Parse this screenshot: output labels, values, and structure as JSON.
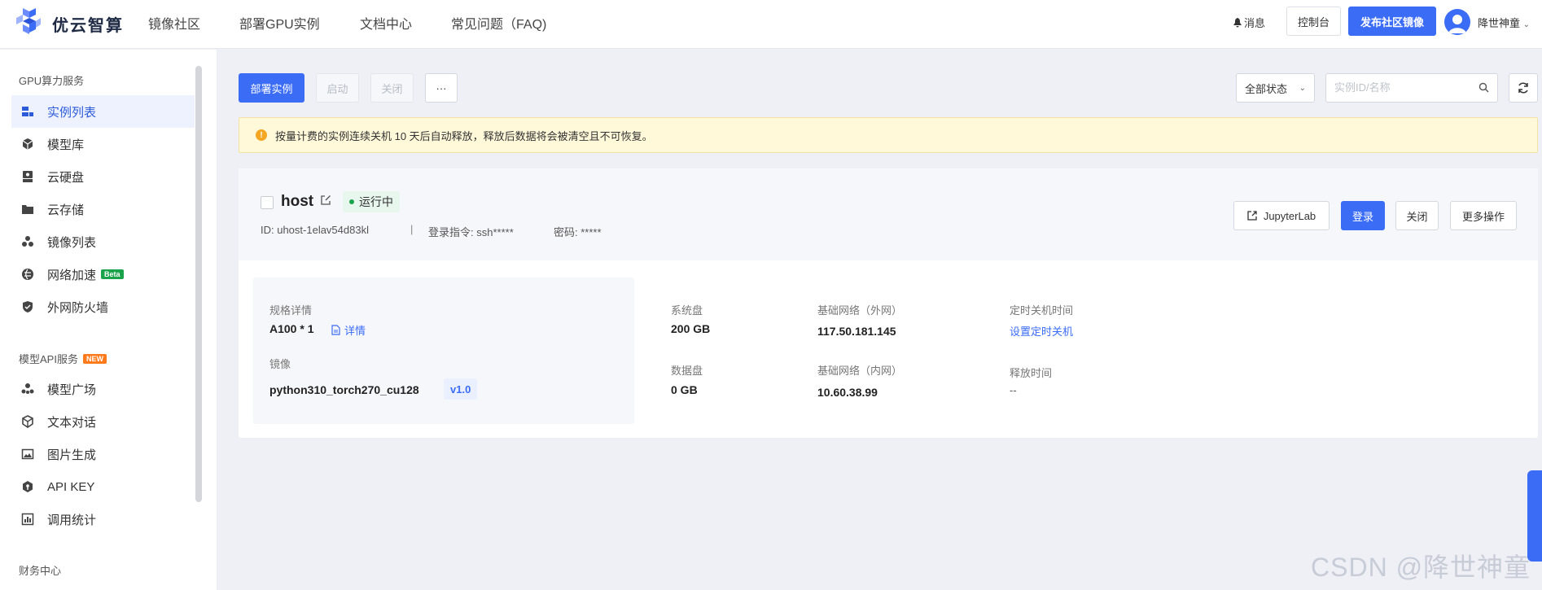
{
  "brand": {
    "name": "优云智算"
  },
  "topnav": [
    {
      "label": "镜像社区"
    },
    {
      "label": "部署GPU实例"
    },
    {
      "label": "文档中心"
    },
    {
      "label": "常见问题（FAQ)"
    }
  ],
  "header": {
    "messages": "消息",
    "console": "控制台",
    "publish": "发布社区镜像",
    "username": "降世神童"
  },
  "sidebar": {
    "gpu_section": "GPU算力服务",
    "gpu_items": [
      {
        "label": "实例列表",
        "icon": "instance-list-icon"
      },
      {
        "label": "模型库",
        "icon": "cube-icon"
      },
      {
        "label": "云硬盘",
        "icon": "disk-icon"
      },
      {
        "label": "云存储",
        "icon": "folder-icon"
      },
      {
        "label": "镜像列表",
        "icon": "image-stack-icon"
      },
      {
        "label": "网络加速",
        "icon": "globe-icon",
        "badge": "Beta"
      },
      {
        "label": "外网防火墙",
        "icon": "shield-icon"
      }
    ],
    "api_section": "模型API服务",
    "api_badge": "NEW",
    "api_items": [
      {
        "label": "模型广场",
        "icon": "model-square-icon"
      },
      {
        "label": "文本对话",
        "icon": "chat-cube-icon"
      },
      {
        "label": "图片生成",
        "icon": "picture-icon"
      },
      {
        "label": "API KEY",
        "icon": "key-hex-icon"
      },
      {
        "label": "调用统计",
        "icon": "bar-chart-icon"
      }
    ],
    "finance_section": "财务中心"
  },
  "toolbar": {
    "deploy": "部署实例",
    "start": "启动",
    "stop": "关闭",
    "more": "···",
    "status_filter": "全部状态",
    "search_placeholder": "实例ID/名称"
  },
  "alert": {
    "text": "按量计费的实例连续关机 10 天后自动释放，释放后数据将会被清空且不可恢复。"
  },
  "instance": {
    "name": "host",
    "status": "运行中",
    "id": "ID: uhost-1elav54d83kl",
    "sep": "|",
    "login_cmd": "登录指令: ssh*****",
    "password": "密码: *****",
    "actions": {
      "jupyter": "JupyterLab",
      "login": "登录",
      "stop": "关闭",
      "more": "更多操作"
    },
    "spec_label": "规格详情",
    "spec_value": "A100 * 1",
    "spec_detail": "详情",
    "image_label": "镜像",
    "image_value": "python310_torch270_cu128",
    "image_version": "v1.0",
    "sys_disk_label": "系统盘",
    "sys_disk_value": "200 GB",
    "data_disk_label": "数据盘",
    "data_disk_value": "0 GB",
    "net_ext_label": "基础网络（外网）",
    "net_ext_value": "117.50.181.145",
    "net_int_label": "基础网络（内网）",
    "net_int_value": "10.60.38.99",
    "shutdown_label": "定时关机时间",
    "shutdown_link": "设置定时关机",
    "release_label": "释放时间",
    "release_value": "--"
  },
  "watermark": "CSDN @降世神童",
  "colors": {
    "primary": "#3b6cf6",
    "running": "#1aa34a",
    "alert_bg": "#fff8d9"
  }
}
